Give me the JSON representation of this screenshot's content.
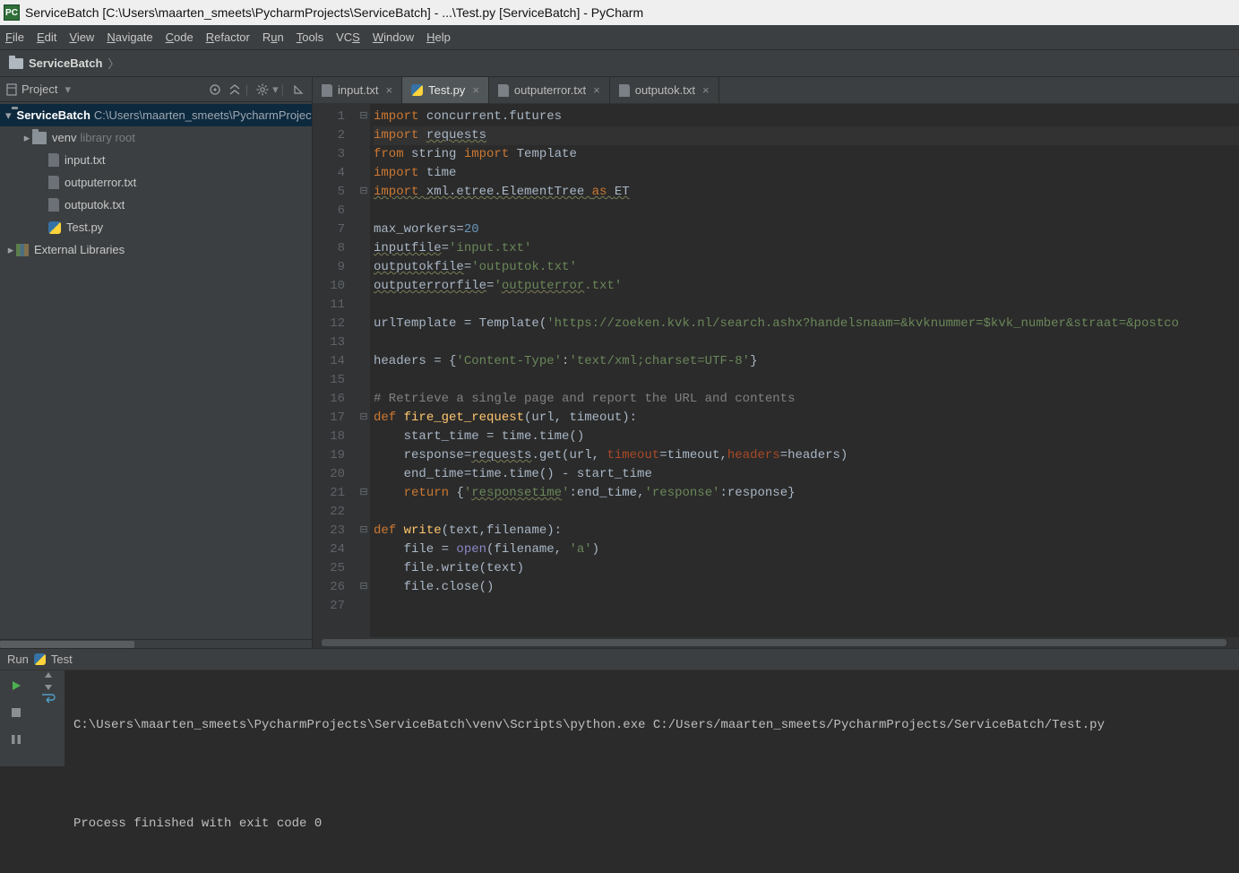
{
  "window": {
    "title": "ServiceBatch [C:\\Users\\maarten_smeets\\PycharmProjects\\ServiceBatch] - ...\\Test.py [ServiceBatch] - PyCharm",
    "app_icon_text": "PC"
  },
  "menu": {
    "items": [
      "File",
      "Edit",
      "View",
      "Navigate",
      "Code",
      "Refactor",
      "Run",
      "Tools",
      "VCS",
      "Window",
      "Help"
    ]
  },
  "breadcrumb": {
    "root": "ServiceBatch"
  },
  "project_tool": {
    "title": "Project"
  },
  "tree": {
    "root": {
      "name": "ServiceBatch",
      "path": "C:\\Users\\maarten_smeets\\PycharmProjects\\ServiceBatch"
    },
    "venv": {
      "name": "venv",
      "suffix": "library root"
    },
    "files": [
      {
        "name": "input.txt",
        "type": "txt"
      },
      {
        "name": "outputerror.txt",
        "type": "txt"
      },
      {
        "name": "outputok.txt",
        "type": "txt"
      },
      {
        "name": "Test.py",
        "type": "py"
      }
    ],
    "external_libs": "External Libraries"
  },
  "tabs": [
    {
      "name": "input.txt",
      "type": "txt",
      "active": false
    },
    {
      "name": "Test.py",
      "type": "py",
      "active": true
    },
    {
      "name": "outputerror.txt",
      "type": "txt",
      "active": false
    },
    {
      "name": "outputok.txt",
      "type": "txt",
      "active": false
    }
  ],
  "editor": {
    "lines": [
      {
        "n": 1,
        "html": "<span class='kw'>import </span>concurrent.futures"
      },
      {
        "n": 2,
        "hl": true,
        "html": "<span class='kw'>import </span><span class='wavy'>requests</span>"
      },
      {
        "n": 3,
        "html": "<span class='kw'>from </span>string <span class='kw'>import </span>Template"
      },
      {
        "n": 4,
        "html": "<span class='kw'>import </span>time"
      },
      {
        "n": 5,
        "html": "<span class='kw wavy'>import </span><span class='wavy'>xml.etree.ElementTree </span><span class='kw wavy'>as </span><span class='wavy'>ET</span>"
      },
      {
        "n": 6,
        "html": ""
      },
      {
        "n": 7,
        "html": "max_workers=<span class='num'>20</span>"
      },
      {
        "n": 8,
        "html": "<span class='wavy'>inputfile</span>=<span class='str'>'input.txt'</span>"
      },
      {
        "n": 9,
        "html": "<span class='wavy'>outputokfile</span>=<span class='str'>'outputok.txt'</span>"
      },
      {
        "n": 10,
        "html": "<span class='wavy'>outputerrorfile</span>=<span class='str'>'<span class='wavy'>outputerror</span>.txt'</span>"
      },
      {
        "n": 11,
        "html": ""
      },
      {
        "n": 12,
        "html": "urlTemplate = Template(<span class='str'>'https://zoeken.kvk.nl/search.ashx?handelsnaam=&amp;kvknummer=$kvk_number&amp;straat=&amp;postco</span>"
      },
      {
        "n": 13,
        "html": ""
      },
      {
        "n": 14,
        "html": "headers = {<span class='str'>'Content-Type'</span>:<span class='str'>'text/xml;charset=UTF-8'</span>}"
      },
      {
        "n": 15,
        "html": ""
      },
      {
        "n": 16,
        "html": "<span class='cm'># Retrieve a single page and report the URL and contents</span>"
      },
      {
        "n": 17,
        "html": "<span class='kw'>def </span><span style='color:#FFC66D'>fire_get_request</span>(url, timeout):"
      },
      {
        "n": 18,
        "html": "    start_time = time.time()"
      },
      {
        "n": 19,
        "html": "    response=<span class='wavy'>requests</span>.get(url, <span style='color:#AA4926'>timeout</span>=timeout,<span style='color:#AA4926'>headers</span>=headers)"
      },
      {
        "n": 20,
        "html": "    end_time=time.time() - start_time"
      },
      {
        "n": 21,
        "html": "    <span class='kw'>return </span>{<span class='str'>'<span class='wavy'>responsetime</span>'</span>:end_time,<span class='str'>'response'</span>:response}"
      },
      {
        "n": 22,
        "html": ""
      },
      {
        "n": 23,
        "html": "<span class='kw'>def </span><span style='color:#FFC66D'>write</span>(text,filename):"
      },
      {
        "n": 24,
        "html": "    file = <span class='builtin'>open</span>(filename, <span class='str'>'a'</span>)"
      },
      {
        "n": 25,
        "html": "    file.write(text)"
      },
      {
        "n": 26,
        "html": "    file.close()"
      },
      {
        "n": 27,
        "html": ""
      }
    ],
    "fold_marks": {
      "1": "⊟",
      "5": "⊟",
      "17": "⊟",
      "21": "⊟",
      "23": "⊟",
      "26": "⊟"
    }
  },
  "run": {
    "tab_label": "Run",
    "config_name": "Test",
    "output_line1": "C:\\Users\\maarten_smeets\\PycharmProjects\\ServiceBatch\\venv\\Scripts\\python.exe C:/Users/maarten_smeets/PycharmProjects/ServiceBatch/Test.py",
    "output_line2": "",
    "output_line3": "Process finished with exit code 0"
  }
}
